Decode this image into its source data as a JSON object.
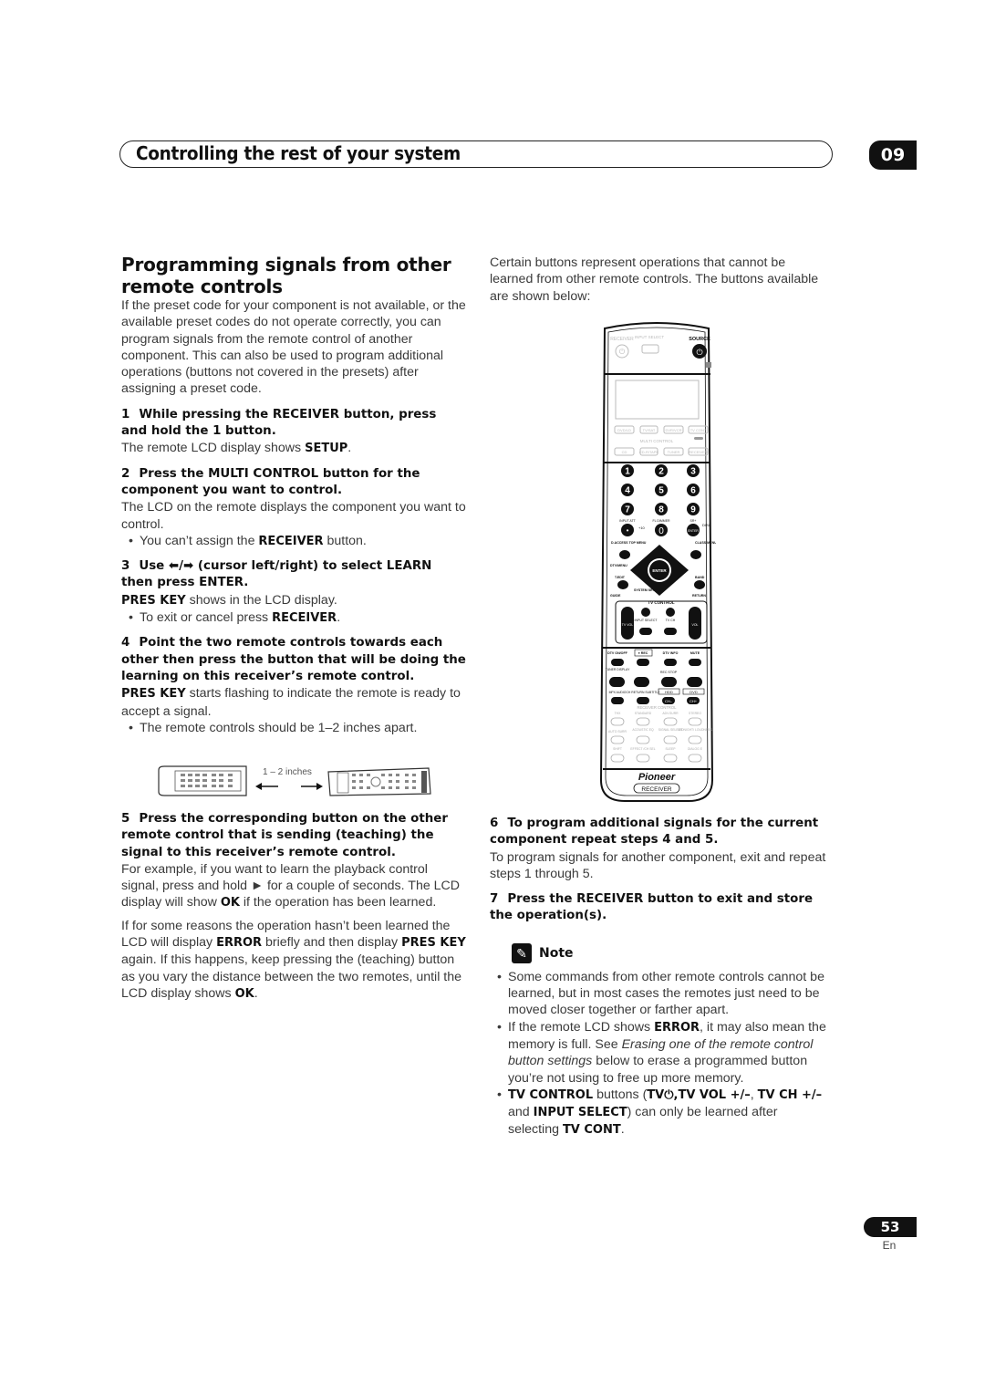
{
  "header": {
    "title": "Controlling the rest of your system",
    "chapter": "09"
  },
  "left": {
    "heading": "Programming signals from other remote controls",
    "intro": "If the preset code for your component is not available, or the available preset codes do not operate correctly, you can program signals from the remote control of another component. This can also be used to program additional operations (buttons not covered in the presets) after assigning a preset code.",
    "step1": {
      "num": "1",
      "title": "While pressing the RECEIVER button, press and hold the 1 button.",
      "body_pre": "The remote LCD display shows ",
      "body_bold": "SETUP",
      "body_post": "."
    },
    "step2": {
      "num": "2",
      "title": "Press the MULTI CONTROL button for the component you want to control.",
      "body": "The LCD on the remote displays the component you want to control.",
      "bullet_pre": "You can’t assign the ",
      "bullet_bold": "RECEIVER",
      "bullet_post": " button."
    },
    "step3": {
      "num": "3",
      "title": "Use ⬅/➡ (cursor left/right) to select LEARN then press ENTER.",
      "body_bold": "PRES KEY",
      "body_post": " shows in the LCD display.",
      "bullet_pre": "To exit or cancel press ",
      "bullet_bold": "RECEIVER",
      "bullet_post": "."
    },
    "step4": {
      "num": "4",
      "title": "Point the two remote controls towards each other then press the button that will be doing the learning on this receiver’s remote control.",
      "body_bold": "PRES KEY",
      "body_post": " starts flashing to indicate the remote is ready to accept a signal.",
      "bullet": "The remote controls should be 1–2 inches apart."
    },
    "figure_label": "1 – 2 inches",
    "step5": {
      "num": "5",
      "title": "Press the corresponding button on the other remote control that is sending (teaching) the signal to this receiver’s remote control.",
      "p1_pre": "For example, if you want to learn the playback control signal, press and hold ► for a couple of seconds. The LCD display will show ",
      "p1_bold": "OK",
      "p1_post": " if the operation has been learned.",
      "p2_a": "If for some reasons the operation hasn’t been learned the LCD will display ",
      "p2_b": "ERROR",
      "p2_c": " briefly and then display ",
      "p2_d": "PRES KEY",
      "p2_e": " again. If this happens, keep pressing the (teaching) button as you vary the distance between the two remotes, until the LCD display shows ",
      "p2_f": "OK",
      "p2_g": "."
    }
  },
  "right": {
    "intro": "Certain buttons represent operations that cannot be learned from other remote controls. The buttons available are shown below:",
    "remote": {
      "top": [
        "RECEIVER",
        "INPUT SELECT",
        "SOURCE"
      ],
      "multi_row1": [
        "DVD/LD",
        "TV/SAT",
        "DVR/VCR",
        "TV CONT"
      ],
      "multi_label": "MULTI CONTROL",
      "multi_row2": [
        "CD",
        "CD-R/TAPE",
        "TUNER",
        "RECEIVER"
      ],
      "digits": [
        "1",
        "2",
        "3",
        "4",
        "5",
        "6",
        "7",
        "8",
        "9"
      ],
      "row_labels": [
        "INPUT ATT",
        "FL DIMMER",
        "SR+"
      ],
      "bottom_digits": [
        "•",
        "0",
        "ENTER"
      ],
      "plus10": "+10",
      "disc": "DISC",
      "nav_labels": [
        "D.ACCESS TOP MENU",
        "CLASS MENU",
        "DTV/MENU",
        "T.EDIT",
        "BAND",
        "GUIDE",
        "SYSTEM SETUP",
        "RETURN"
      ],
      "enter": "ENTER",
      "tv_control": "TV CONTROL",
      "tv_vol": "TV VOL",
      "input_select": "INPUT SELECT",
      "tv_ch": "TV CH",
      "vol": "VOL",
      "transport_labels": [
        "DTV ON/OFF",
        "● REC",
        "DTV INFO",
        "MUTE"
      ],
      "tuner_display": "TUNER DISPLAY",
      "rec_stop": "REC STOP",
      "mpx_audio": "MPX AUDIO",
      "ch_return": "CH RETURN SUBTITLE",
      "hdd": "HDD",
      "dvd": "DVD",
      "ch_minus": "CH–",
      "ch_plus": "CH+",
      "receiver_control": "RECEIVER CONTROL",
      "rc_row1": [
        "THX",
        "STANDARD",
        "ADV.SURR",
        "STEREO"
      ],
      "rc_row2": [
        "AUTO SURR",
        "ACOUSTIC EQ",
        "SIGNAL SELECT",
        "MIDNIGHT/ LOUDNESS"
      ],
      "rc_row3": [
        "SHIFT",
        "EFFECT /CH SEL",
        "SLEEP",
        "DIALOG E"
      ],
      "brand": "Pioneer",
      "receiver_btn": "RECEIVER"
    },
    "step6": {
      "num": "6",
      "title": "To program additional signals for the current component repeat steps 4 and 5.",
      "body": "To program signals for another component, exit and repeat steps 1 through 5."
    },
    "step7": {
      "num": "7",
      "title": "Press the RECEIVER button to exit and store the operation(s)."
    },
    "note_label": "Note",
    "note1": "Some commands from other remote controls cannot be learned, but in most cases the remotes just need to be moved closer together or farther apart.",
    "note2": {
      "a": "If the remote LCD shows ",
      "b": "ERROR",
      "c": ", it may also mean the memory is full. See ",
      "d": "Erasing one of the remote control button settings",
      "e": " below to erase a programmed button you’re not using to free up more memory."
    },
    "note3": {
      "a": "TV CONTROL",
      "b": " buttons (",
      "c": "TV⏻,TV VOL +/–",
      "d": ", ",
      "e": "TV CH +/–",
      "f": " and ",
      "g": "INPUT SELECT",
      "h": ") can only be learned after selecting ",
      "i": "TV CONT",
      "j": "."
    }
  },
  "footer": {
    "page": "53",
    "lang": "En"
  }
}
